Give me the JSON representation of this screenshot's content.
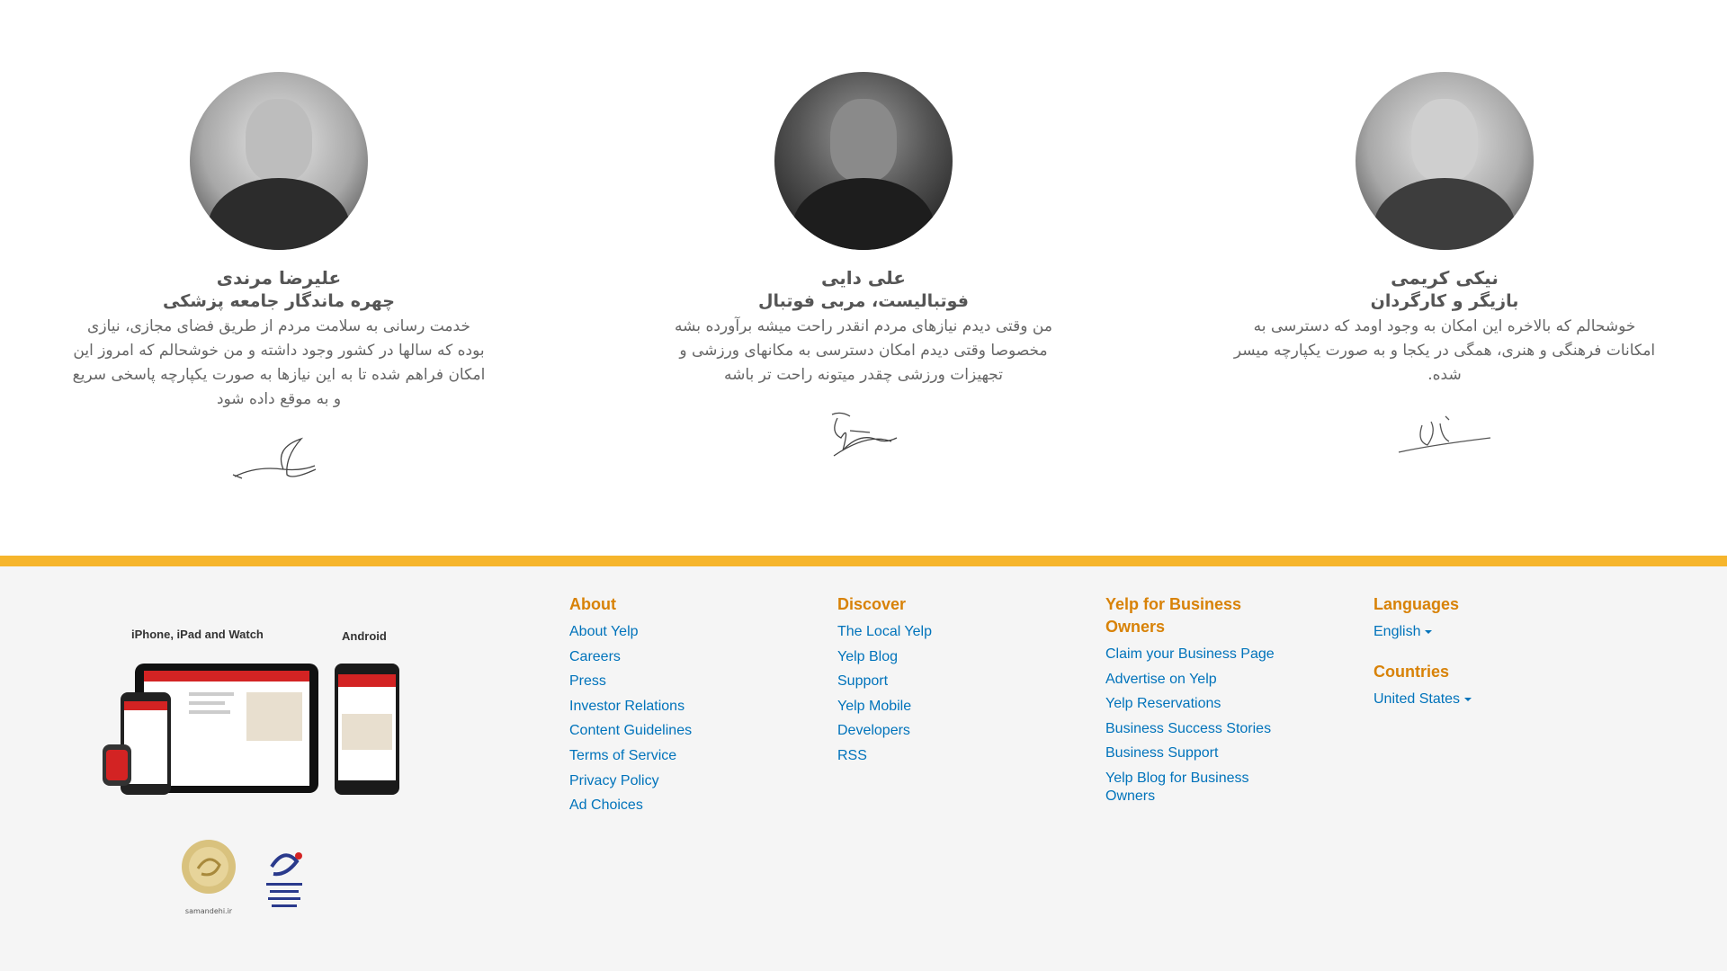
{
  "testimonials": [
    {
      "name": "علیرضا مرندی",
      "role": "چهره ماندگار جامعه پزشکی",
      "quote": "خدمت رسانی به سلامت مردم از طریق فضای مجازی، نیازی بوده که سالها در کشور وجود داشته و من خوشحالم که امروز این امکان فراهم شده تا به این نیازها به صورت یکپارچه پاسخی سریع و به موقع داده شود"
    },
    {
      "name": "علی دایی",
      "role": "فوتبالیست، مربی فوتبال",
      "quote": "من وقتی دیدم نیازهای مردم انقدر راحت میشه برآورده بشه مخصوصا وقتی دیدم امکان دسترسی به مکانهای ورزشی و تجهیزات ورزشی چقدر میتونه راحت تر باشه"
    },
    {
      "name": "نیکی کریمی",
      "role": "بازیگر و کارگردان",
      "quote": "خوشحالم که بالاخره این امکان به وجود اومد که دسترسی به امکانات فرهنگی و هنری، همگی در یکجا و به صورت یکپارچه میسر شده."
    }
  ],
  "footer": {
    "apps": {
      "ios_label": "iPhone, iPad and  Watch",
      "android_label": "Android"
    },
    "badges": {
      "samandehi_text": "samandehi.ir"
    },
    "about": {
      "title": "About",
      "links": [
        "About Yelp",
        "Careers",
        "Press",
        "Investor Relations",
        "Content Guidelines",
        "Terms of Service",
        "Privacy Policy",
        "Ad Choices"
      ]
    },
    "discover": {
      "title": "Discover",
      "links": [
        "The Local Yelp",
        "Yelp Blog",
        "Support",
        "Yelp Mobile",
        "Developers",
        "RSS"
      ]
    },
    "business": {
      "title": "Yelp for Business Owners",
      "links": [
        "Claim your Business Page",
        "Advertise on Yelp",
        "Yelp Reservations",
        "Business Success Stories",
        "Business Support",
        "Yelp Blog for Business Owners"
      ]
    },
    "languages": {
      "title": "Languages",
      "selected": "English"
    },
    "countries": {
      "title": "Countries",
      "selected": "United States"
    },
    "colors": {
      "accent_bar": "#f6b52c",
      "heading": "#d88207",
      "link": "#0073bb"
    }
  }
}
